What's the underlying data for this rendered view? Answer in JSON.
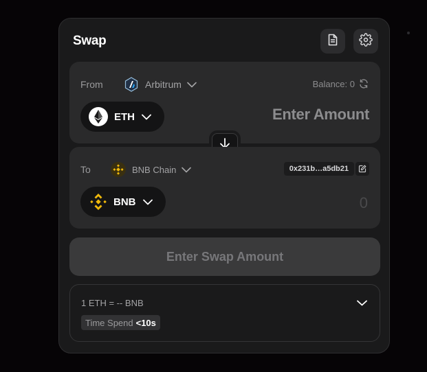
{
  "swap": {
    "title": "Swap",
    "from": {
      "label": "From",
      "chain": "Arbitrum",
      "balance": "Balance: 0",
      "token": "ETH",
      "amount_placeholder": "Enter Amount"
    },
    "to": {
      "label": "To",
      "chain": "BNB Chain",
      "address": "0x231b…a5db21",
      "token": "BNB",
      "amount": "0"
    },
    "cta_label": "Enter Swap Amount",
    "info": {
      "rate": "1 ETH = -- BNB",
      "time_label": "Time Spend",
      "time_value": "<10s"
    }
  },
  "colors": {
    "background": "#060406",
    "card": "#1a1a1b",
    "panel": "#2a2a2b",
    "eth_badge": "#ffffff",
    "bnb_gold": "#f0b90b",
    "arbitrum_blue": "#28a0f0"
  },
  "icons": [
    "document-icon",
    "settings-gear-icon",
    "arbitrum-logo-icon",
    "eth-logo-icon",
    "bnb-chain-logo-icon",
    "bnb-logo-icon",
    "refresh-icon",
    "arrow-down-icon",
    "edit-icon",
    "chevron-down-icon"
  ]
}
